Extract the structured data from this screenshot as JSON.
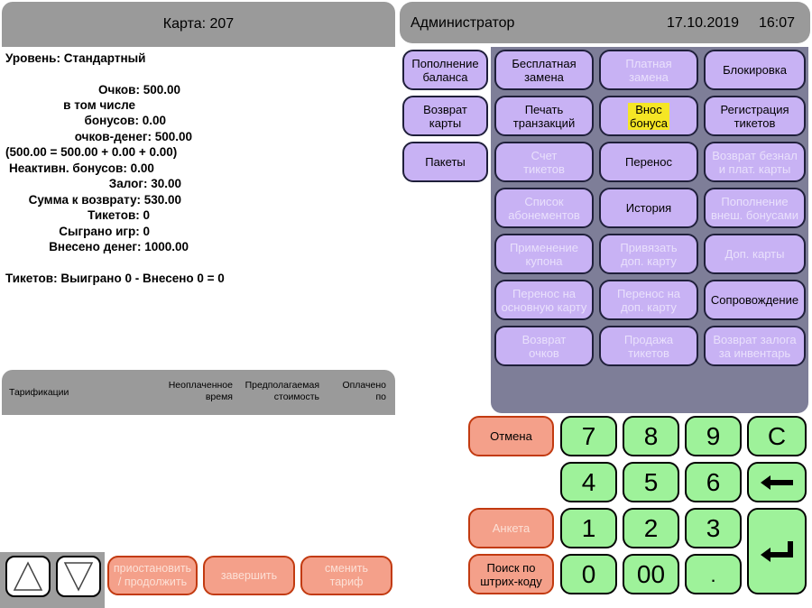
{
  "card": {
    "title": "Карта: 207"
  },
  "info": {
    "level": "Уровень: Стандартный",
    "points": "Очков: 500.00",
    "including": "в том числе",
    "bonuses": "бонусов: 0.00",
    "money_points": "очков-денег: 500.00",
    "formula": "(500.00 = 500.00 + 0.00 + 0.00)",
    "inactive_bonuses": "Неактивн. бонусов: 0.00",
    "deposit": "Залог: 30.00",
    "refund_sum": "Сумма к возврату: 530.00",
    "tickets": "Тикетов: 0",
    "games_played": "Сыграно игр: 0",
    "money_deposited": "Внесено денег: 1000.00",
    "tickets_summary": "Тикетов: Выиграно 0 - Внесено 0 = 0"
  },
  "tariff_table": {
    "col1": "Тарификации",
    "col2_l1": "Неоплаченное",
    "col2_l2": "время",
    "col3_l1": "Предполагаемая",
    "col3_l2": "стоимость",
    "col4_l1": "Оплачено",
    "col4_l2": "по"
  },
  "bottom_left": {
    "suspend_l1": "приостановить",
    "suspend_l2": "/ продолжить",
    "finish": "завершить",
    "change_l1": "сменить",
    "change_l2": "тариф"
  },
  "header": {
    "role": "Администратор",
    "date": "17.10.2019",
    "time": "16:07"
  },
  "left_col": {
    "top_up_l1": "Пополнение",
    "top_up_l2": "баланса",
    "return_l1": "Возврат",
    "return_l2": "карты",
    "packages": "Пакеты"
  },
  "grid": {
    "free_replace_l1": "Бесплатная",
    "free_replace_l2": "замена",
    "paid_replace_l1": "Платная",
    "paid_replace_l2": "замена",
    "block": "Блокировка",
    "print_l1": "Печать",
    "print_l2": "транзакций",
    "bonus_l1": "Внос",
    "bonus_l2": "бонуса",
    "reg_tickets_l1": "Регистрация",
    "reg_tickets_l2": "тикетов",
    "ticket_acc_l1": "Счет",
    "ticket_acc_l2": "тикетов",
    "transfer": "Перенос",
    "ret_cash_l1": "Возврат безнал",
    "ret_cash_l2": "и плат. карты",
    "subs_l1": "Список",
    "subs_l2": "абонементов",
    "history": "История",
    "ext_bonus_l1": "Пополнение",
    "ext_bonus_l2": "внеш. бонусами",
    "coupon_l1": "Применение",
    "coupon_l2": "купона",
    "bind_l1": "Привязать",
    "bind_l2": "доп. карту",
    "extra_cards": "Доп. карты",
    "to_main_l1": "Перенос на",
    "to_main_l2": "основную карту",
    "to_extra_l1": "Перенос на",
    "to_extra_l2": "доп. карту",
    "escort": "Сопровождение",
    "ret_points_l1": "Возврат",
    "ret_points_l2": "очков",
    "sell_tickets_l1": "Продажа",
    "sell_tickets_l2": "тикетов",
    "ret_deposit_l1": "Возврат залога",
    "ret_deposit_l2": "за инвентарь"
  },
  "actions": {
    "cancel": "Отмена",
    "survey": "Анкета",
    "barcode_l1": "Поиск по",
    "barcode_l2": "штрих-коду"
  },
  "numpad": {
    "k7": "7",
    "k8": "8",
    "k9": "9",
    "clear": "C",
    "k4": "4",
    "k5": "5",
    "k6": "6",
    "k1": "1",
    "k2": "2",
    "k3": "3",
    "k0": "0",
    "k00": "00",
    "dot": "."
  },
  "colors": {
    "header_gray": "#9a9a9a",
    "grid_bg": "#7e7e98",
    "button_violet": "#c8b2f4",
    "numpad_green": "#9ef29a",
    "action_salmon": "#f4a08a",
    "highlight_yellow": "#f5e625"
  }
}
